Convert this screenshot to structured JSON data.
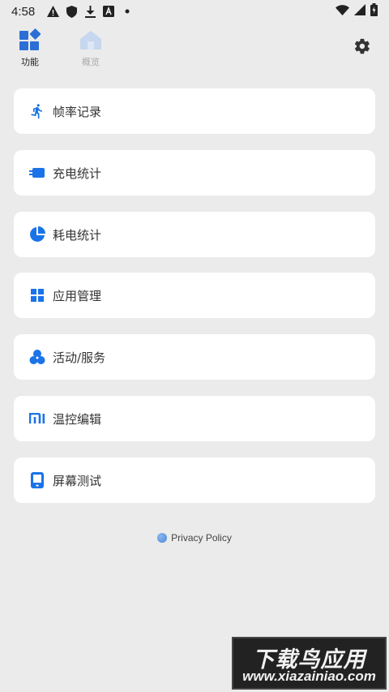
{
  "status_bar": {
    "time": "4:58",
    "left_icons": [
      "warning-icon",
      "shield-icon",
      "download-icon",
      "font-icon",
      "dot-icon"
    ],
    "right_icons": [
      "wifi-icon",
      "signal-icon",
      "battery-icon"
    ]
  },
  "nav": {
    "tabs": [
      {
        "label": "功能",
        "icon": "widgets-icon",
        "active": true
      },
      {
        "label": "概览",
        "icon": "home-icon",
        "active": false
      }
    ],
    "settings_icon": "gear-icon"
  },
  "menu": {
    "items": [
      {
        "label": "帧率记录",
        "icon": "running-icon"
      },
      {
        "label": "充电统计",
        "icon": "charging-icon"
      },
      {
        "label": "耗电统计",
        "icon": "pie-chart-icon"
      },
      {
        "label": "应用管理",
        "icon": "grid-icon"
      },
      {
        "label": "活动/服务",
        "icon": "circles-icon"
      },
      {
        "label": "温控编辑",
        "icon": "mi-icon"
      },
      {
        "label": "屏幕测试",
        "icon": "phone-screen-icon"
      }
    ]
  },
  "footer": {
    "privacy_label": "Privacy Policy"
  },
  "watermark": {
    "title": "下载鸟应用",
    "url": "www.xiazainiao.com"
  },
  "colors": {
    "background": "#ebebeb",
    "card": "#ffffff",
    "accent": "#1a73e8",
    "text": "#333333"
  }
}
